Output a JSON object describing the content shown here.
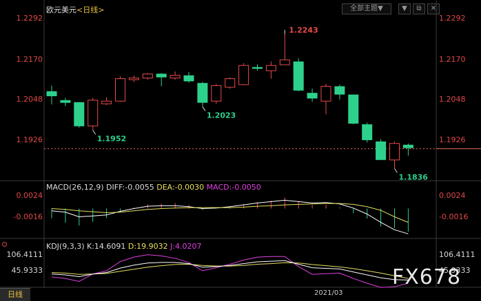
{
  "symbol": {
    "name": "欧元美元",
    "period": "<日线>"
  },
  "toolbar": {
    "theme_label": "全部主题▼",
    "dropdown_glyph": "▼",
    "restore_glyph": "⧉",
    "close_glyph": "✕"
  },
  "price_axis": {
    "labels": [
      "1.2292",
      "1.2170",
      "1.2048",
      "1.1926"
    ]
  },
  "annotations": {
    "high": "1.2243",
    "low1": "1.1952",
    "low2": "1.2023",
    "low3": "1.1836"
  },
  "macd": {
    "header": "MACD(26,12,9)",
    "diff": "DIFF:-0.0055",
    "dea": "DEA:-0.0030",
    "macd": "MACD:-0.0050",
    "axis": [
      "0.0024",
      "-0.0016"
    ]
  },
  "kdj": {
    "header": "KDJ(9,3,3)",
    "k": "K:14.6091",
    "d": "D:19.9032",
    "j": "J:4.0207",
    "axis": [
      "106.4111",
      "45.9333"
    ]
  },
  "footer": {
    "period_tab": "日线",
    "date_label": "2021/03"
  },
  "watermark": "FX678",
  "colors": {
    "up": "#e84a4a",
    "down": "#2ed18c",
    "diff": "#ffffff",
    "dea": "#e8e060",
    "j": "#e040e0",
    "current_line": "#e87060"
  },
  "chart_data": {
    "type": "candlestick",
    "title": "欧元美元 <日线>",
    "ylim": [
      1.18,
      1.23
    ],
    "candles": [
      {
        "o": 1.207,
        "h": 1.2087,
        "l": 1.203,
        "c": 1.2055
      },
      {
        "o": 1.2043,
        "h": 1.205,
        "l": 1.2025,
        "c": 1.2035
      },
      {
        "o": 1.2037,
        "h": 1.2037,
        "l": 1.196,
        "c": 1.1964
      },
      {
        "o": 1.1965,
        "h": 1.205,
        "l": 1.1952,
        "c": 1.2043
      },
      {
        "o": 1.2032,
        "h": 1.2052,
        "l": 1.2028,
        "c": 1.204
      },
      {
        "o": 1.204,
        "h": 1.2115,
        "l": 1.2038,
        "c": 1.2108
      },
      {
        "o": 1.2105,
        "h": 1.2117,
        "l": 1.2098,
        "c": 1.211
      },
      {
        "o": 1.211,
        "h": 1.2125,
        "l": 1.2105,
        "c": 1.2122
      },
      {
        "o": 1.2123,
        "h": 1.2125,
        "l": 1.2085,
        "c": 1.2112
      },
      {
        "o": 1.211,
        "h": 1.213,
        "l": 1.2105,
        "c": 1.2118
      },
      {
        "o": 1.2118,
        "h": 1.2128,
        "l": 1.2096,
        "c": 1.21
      },
      {
        "o": 1.2095,
        "h": 1.2098,
        "l": 1.2023,
        "c": 1.2035
      },
      {
        "o": 1.204,
        "h": 1.2092,
        "l": 1.2032,
        "c": 1.2087
      },
      {
        "o": 1.2082,
        "h": 1.2112,
        "l": 1.2078,
        "c": 1.2108
      },
      {
        "o": 1.209,
        "h": 1.2155,
        "l": 1.2088,
        "c": 1.2148
      },
      {
        "o": 1.2143,
        "h": 1.2152,
        "l": 1.2132,
        "c": 1.2138
      },
      {
        "o": 1.2132,
        "h": 1.216,
        "l": 1.2108,
        "c": 1.2148
      },
      {
        "o": 1.215,
        "h": 1.2243,
        "l": 1.215,
        "c": 1.2165
      },
      {
        "o": 1.216,
        "h": 1.217,
        "l": 1.207,
        "c": 1.2072
      },
      {
        "o": 1.2065,
        "h": 1.2078,
        "l": 1.2038,
        "c": 1.2048
      },
      {
        "o": 1.204,
        "h": 1.2092,
        "l": 1.2,
        "c": 1.2085
      },
      {
        "o": 1.2085,
        "h": 1.209,
        "l": 1.2045,
        "c": 1.206
      },
      {
        "o": 1.206,
        "h": 1.206,
        "l": 1.197,
        "c": 1.1972
      },
      {
        "o": 1.197,
        "h": 1.1975,
        "l": 1.1915,
        "c": 1.1922
      },
      {
        "o": 1.1918,
        "h": 1.1925,
        "l": 1.1862,
        "c": 1.1862
      },
      {
        "o": 1.1862,
        "h": 1.1918,
        "l": 1.1836,
        "c": 1.1912
      },
      {
        "o": 1.1908,
        "h": 1.1912,
        "l": 1.1875,
        "c": 1.1898
      }
    ],
    "current_price": 1.1896,
    "macd_ylim": [
      -0.0062,
      0.0038
    ],
    "macd_hist": [
      -0.0021,
      -0.0031,
      -0.0037,
      -0.0029,
      -0.0021,
      -0.0005,
      0.0002,
      0.0009,
      0.0011,
      0.0012,
      0.0008,
      -0.0003,
      0.0,
      0.0004,
      0.001,
      0.0014,
      0.0017,
      0.0024,
      0.0016,
      0.0008,
      0.0008,
      0.0003,
      -0.001,
      -0.0022,
      -0.0039,
      -0.0042,
      -0.005
    ],
    "macd_diff": [
      -0.0005,
      -0.0008,
      -0.0018,
      -0.0016,
      -0.0014,
      -0.0006,
      0.0,
      0.0005,
      0.0006,
      0.0006,
      0.0004,
      0.0,
      0.0001,
      0.0004,
      0.0008,
      0.0012,
      0.0015,
      0.0018,
      0.0015,
      0.0012,
      0.0013,
      0.001,
      0.0001,
      -0.0012,
      -0.003,
      -0.0046,
      -0.0055
    ],
    "macd_dea": [
      0.0,
      -0.0002,
      -0.0005,
      -0.0007,
      -0.0009,
      -0.0008,
      -0.0005,
      -0.0002,
      0.0,
      0.0001,
      0.0002,
      0.0002,
      0.0002,
      0.0002,
      0.0003,
      0.0005,
      0.0006,
      0.0008,
      0.0009,
      0.001,
      0.0011,
      0.0011,
      0.0009,
      0.0004,
      -0.0004,
      -0.0018,
      -0.003
    ],
    "kdj_ylim": [
      -5,
      120
    ],
    "kdj_k": [
      35,
      32,
      26,
      35,
      40,
      55,
      65,
      72,
      74,
      74,
      70,
      58,
      60,
      64,
      70,
      76,
      78,
      80,
      68,
      56,
      54,
      52,
      42,
      32,
      22,
      16,
      14.6
    ],
    "kdj_d": [
      40,
      38,
      34,
      35,
      37,
      44,
      51,
      58,
      63,
      67,
      68,
      64,
      62,
      62,
      64,
      68,
      70,
      73,
      72,
      67,
      63,
      59,
      53,
      46,
      38,
      29,
      19.9
    ],
    "kdj_j": [
      25,
      20,
      10,
      35,
      46,
      77,
      92,
      100,
      96,
      88,
      74,
      46,
      56,
      68,
      82,
      92,
      94,
      94,
      60,
      34,
      36,
      38,
      20,
      4,
      -10,
      -8,
      4.0
    ]
  }
}
